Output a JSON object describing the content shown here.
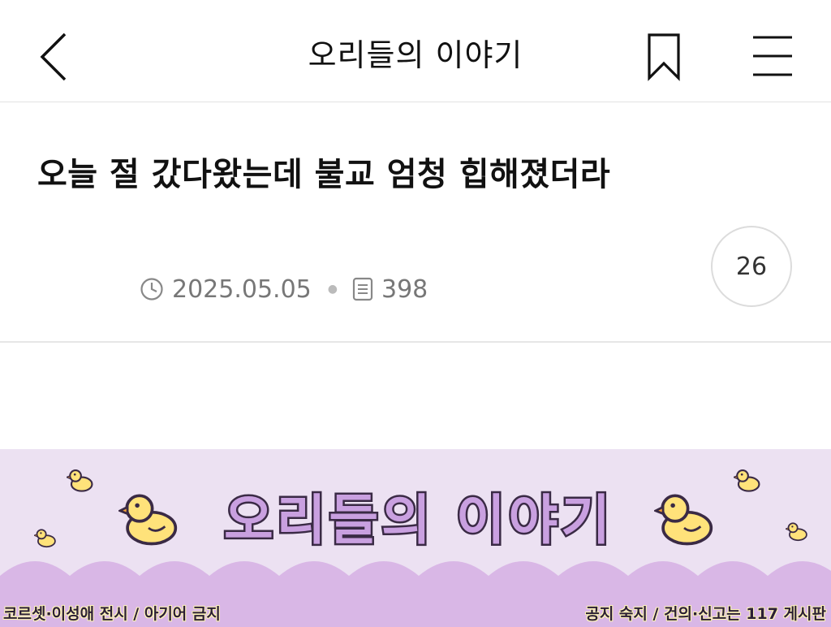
{
  "nav": {
    "title": "오리들의 이야기",
    "back_icon": "chevron-left-icon",
    "bookmark_icon": "bookmark-icon",
    "menu_icon": "hamburger-menu-icon"
  },
  "post": {
    "title": "오늘 절 갔다왔는데 불교 엄청 힙해졌더라",
    "date": "2025.05.05",
    "views": "398",
    "comment_count": "26"
  },
  "banner": {
    "title": "오리들의 이야기",
    "footer_left": "코르셋·이성애 전시 / 아기어 금지",
    "footer_right": "공지 숙지 / 건의·신고는 117 게시판",
    "colors": {
      "background": "#ece1f2",
      "scallop": "#d9b7e6",
      "title_fill": "#c9a0e0",
      "title_outline": "#3a2a45",
      "duck_yellow": "#ffe27a"
    }
  }
}
